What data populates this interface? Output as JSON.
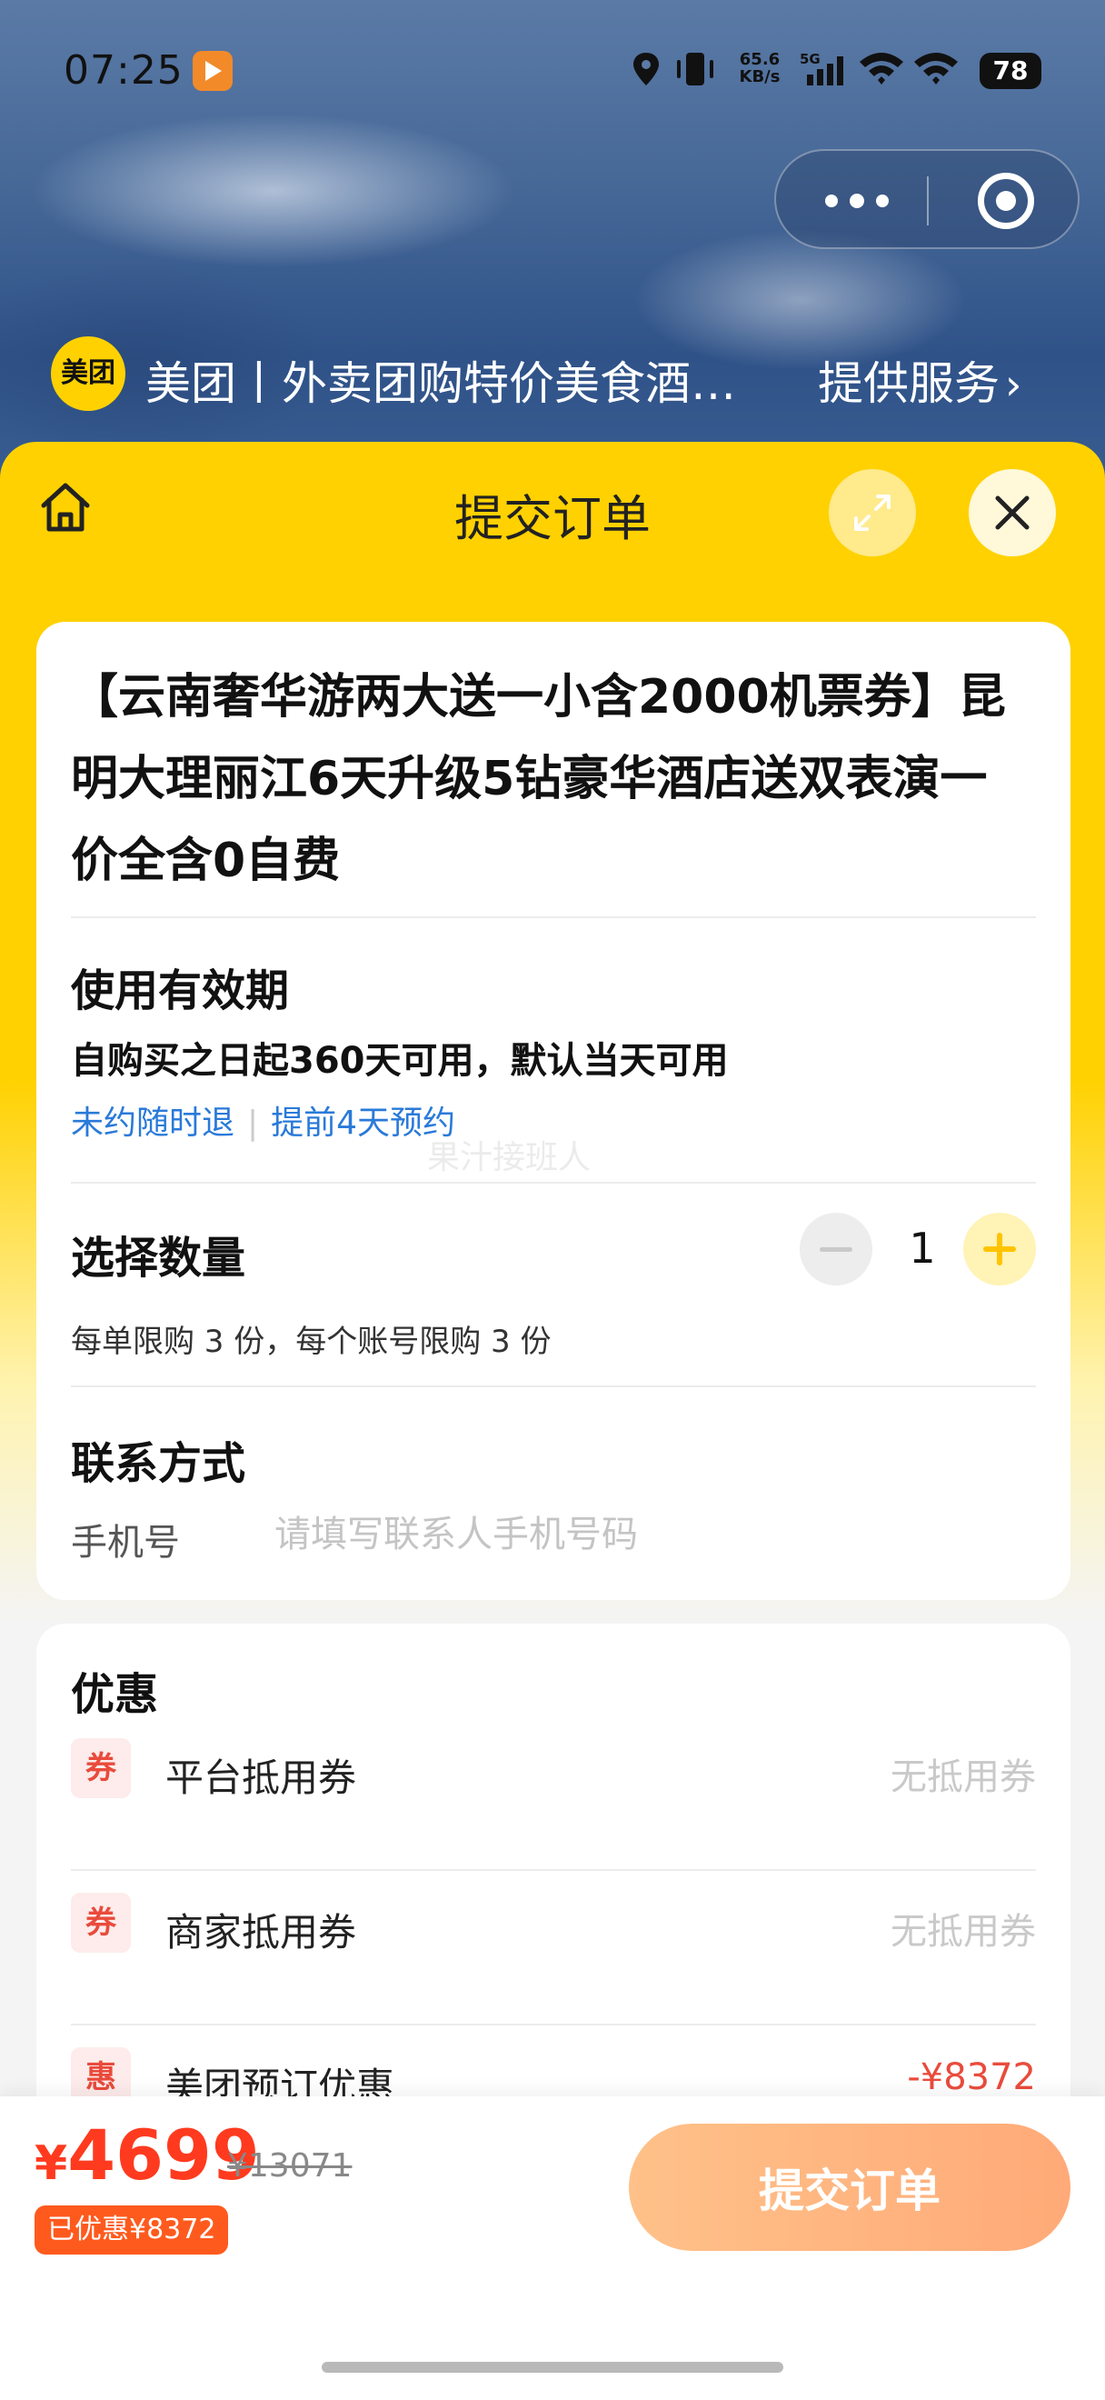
{
  "status_bar": {
    "time": "07:25",
    "net_speed_value": "65.6",
    "net_speed_unit": "KB/s",
    "network_type": "5G",
    "battery": "78"
  },
  "provider": {
    "logo_text": "美团",
    "title": "美团丨外卖团购特价美食酒…",
    "service_label": "提供服务",
    "service_chevron": "›"
  },
  "sheet": {
    "title": "提交订单"
  },
  "product": {
    "title": "【云南奢华游两大送一小含2000机票券】昆明大理丽江6天升级5钻豪华酒店送双表演一价全含0自费"
  },
  "validity": {
    "heading": "使用有效期",
    "text": "自购买之日起360天可用，默认当天可用",
    "tag1": "未约随时退",
    "tag_sep": "|",
    "tag2": "提前4天预约",
    "watermark": "果汁接班人"
  },
  "quantity": {
    "heading": "选择数量",
    "value": "1",
    "limit_text": "每单限购 3 份，每个账号限购 3 份"
  },
  "contact": {
    "heading": "联系方式",
    "phone_label": "手机号",
    "phone_placeholder": "请填写联系人手机号码",
    "phone_value": ""
  },
  "discounts": {
    "heading": "优惠",
    "items": [
      {
        "badge": "券",
        "label": "平台抵用券",
        "value": "无抵用券"
      },
      {
        "badge": "券",
        "label": "商家抵用券",
        "value": "无抵用券"
      },
      {
        "badge": "惠",
        "label": "美团预订优惠",
        "value": "-¥8372"
      }
    ]
  },
  "bottom": {
    "currency": "¥",
    "price": "4699",
    "original_price": "¥13071",
    "saved": "已优惠¥8372",
    "submit_label": "提交订单"
  },
  "colors": {
    "brand_yellow": "#ffd100",
    "price_red": "#ff3a1f",
    "tag_blue": "#2a7ad9",
    "submit_gradient_start": "#ffc189",
    "submit_gradient_end": "#ffaa78"
  }
}
